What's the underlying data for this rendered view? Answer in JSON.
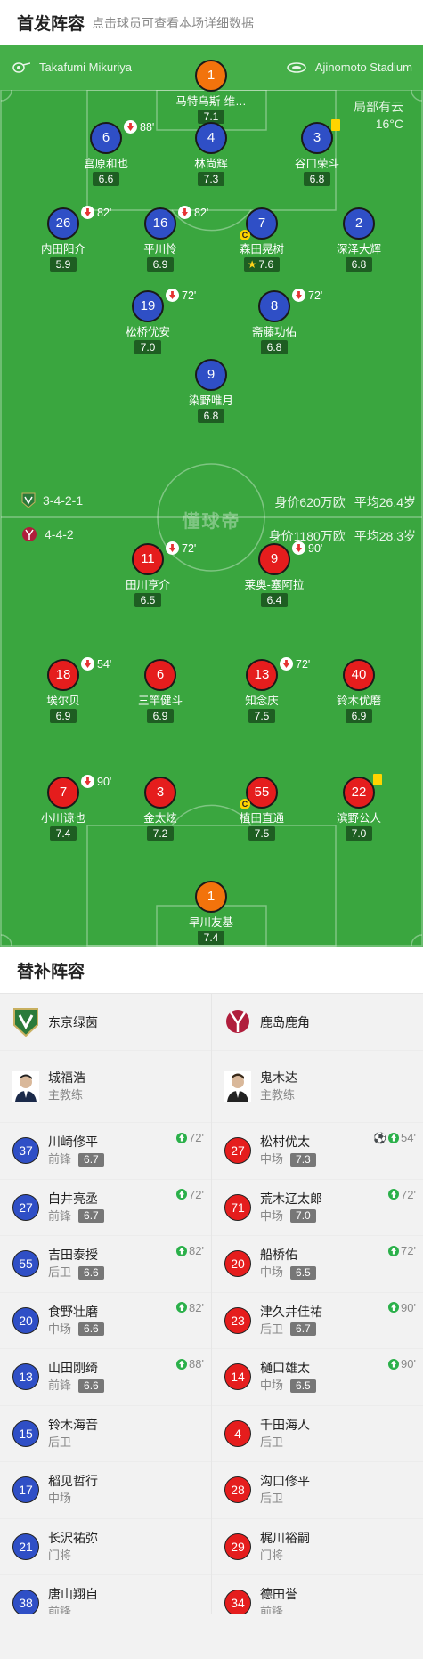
{
  "header": {
    "title": "首发阵容",
    "hint": "点击球员可查看本场详细数据"
  },
  "match": {
    "referee": "Takafumi Mikuriya",
    "stadium": "Ajinomoto Stadium",
    "weather": "局部有云",
    "temperature": "16°C",
    "watermark": "懂球帝"
  },
  "home": {
    "formation": "3-4-2-1",
    "value": "身价620万欧",
    "avg_age": "平均26.4岁",
    "players": [
      {
        "num": "1",
        "name": "马特乌斯-维…",
        "rating": "7.1"
      },
      {
        "num": "6",
        "name": "宫原和也",
        "rating": "6.6",
        "sub": "88'"
      },
      {
        "num": "4",
        "name": "林尚辉",
        "rating": "7.3"
      },
      {
        "num": "3",
        "name": "谷口荣斗",
        "rating": "6.8"
      },
      {
        "num": "26",
        "name": "内田阳介",
        "rating": "5.9",
        "sub": "82'"
      },
      {
        "num": "16",
        "name": "平川怜",
        "rating": "6.9",
        "sub": "82'"
      },
      {
        "num": "7",
        "name": "森田晃树",
        "rating": "7.6"
      },
      {
        "num": "2",
        "name": "深泽大辉",
        "rating": "6.8"
      },
      {
        "num": "19",
        "name": "松桥优安",
        "rating": "7.0",
        "sub": "72'"
      },
      {
        "num": "8",
        "name": "斋藤功佑",
        "rating": "6.8",
        "sub": "72'"
      },
      {
        "num": "9",
        "name": "染野唯月",
        "rating": "6.8"
      }
    ]
  },
  "away": {
    "formation": "4-4-2",
    "value": "身价1180万欧",
    "avg_age": "平均28.3岁",
    "players": [
      {
        "num": "11",
        "name": "田川亨介",
        "rating": "6.5",
        "sub": "72'"
      },
      {
        "num": "9",
        "name": "莱奥-塞阿拉",
        "rating": "6.4",
        "sub": "90'"
      },
      {
        "num": "18",
        "name": "埃尔贝",
        "rating": "6.9",
        "sub": "54'"
      },
      {
        "num": "6",
        "name": "三竿健斗",
        "rating": "6.9"
      },
      {
        "num": "13",
        "name": "知念庆",
        "rating": "7.5",
        "sub": "72'"
      },
      {
        "num": "40",
        "name": "铃木优磨",
        "rating": "6.9"
      },
      {
        "num": "7",
        "name": "小川谅也",
        "rating": "7.4",
        "sub": "90'"
      },
      {
        "num": "3",
        "name": "金太炫",
        "rating": "7.2"
      },
      {
        "num": "55",
        "name": "植田直通",
        "rating": "7.5"
      },
      {
        "num": "22",
        "name": "滨野公人",
        "rating": "7.0"
      },
      {
        "num": "1",
        "name": "早川友基",
        "rating": "7.4"
      }
    ]
  },
  "subs": {
    "title": "替补阵容",
    "home": {
      "team": "东京绿茵",
      "coach": {
        "name": "城福浩",
        "role": "主教练"
      },
      "players": [
        {
          "num": "37",
          "name": "川崎修平",
          "pos": "前锋",
          "rating": "6.7",
          "time": "72'"
        },
        {
          "num": "27",
          "name": "白井亮丞",
          "pos": "前锋",
          "rating": "6.7",
          "time": "72'"
        },
        {
          "num": "55",
          "name": "吉田泰授",
          "pos": "后卫",
          "rating": "6.6",
          "time": "82'"
        },
        {
          "num": "20",
          "name": "食野壮磨",
          "pos": "中场",
          "rating": "6.6",
          "time": "82'"
        },
        {
          "num": "13",
          "name": "山田刚绮",
          "pos": "前锋",
          "rating": "6.6",
          "time": "88'"
        },
        {
          "num": "15",
          "name": "铃木海音",
          "pos": "后卫"
        },
        {
          "num": "17",
          "name": "稻见哲行",
          "pos": "中场"
        },
        {
          "num": "21",
          "name": "长沢祐弥",
          "pos": "门将"
        },
        {
          "num": "38",
          "name": "唐山翔自",
          "pos": "前锋"
        }
      ]
    },
    "away": {
      "team": "鹿岛鹿角",
      "coach": {
        "name": "鬼木达",
        "role": "主教练"
      },
      "players": [
        {
          "num": "27",
          "name": "松村优太",
          "pos": "中场",
          "rating": "7.3",
          "time": "54'",
          "goal": true
        },
        {
          "num": "71",
          "name": "荒木辽太郎",
          "pos": "中场",
          "rating": "7.0",
          "time": "72'"
        },
        {
          "num": "20",
          "name": "船桥佑",
          "pos": "中场",
          "rating": "6.5",
          "time": "72'"
        },
        {
          "num": "23",
          "name": "津久井佳祐",
          "pos": "后卫",
          "rating": "6.7",
          "time": "90'"
        },
        {
          "num": "14",
          "name": "樋口雄太",
          "pos": "中场",
          "rating": "6.5",
          "time": "90'"
        },
        {
          "num": "4",
          "name": "千田海人",
          "pos": "后卫"
        },
        {
          "num": "28",
          "name": "沟口修平",
          "pos": "后卫"
        },
        {
          "num": "29",
          "name": "梶川裕嗣",
          "pos": "门将"
        },
        {
          "num": "34",
          "name": "德田誉",
          "pos": "前锋"
        }
      ]
    }
  },
  "colors": {
    "pitch": "#3aa63f",
    "home": "#2f4fc6",
    "away": "#e51d1d",
    "keeper": "#f2730c",
    "card": "#ffd400"
  }
}
